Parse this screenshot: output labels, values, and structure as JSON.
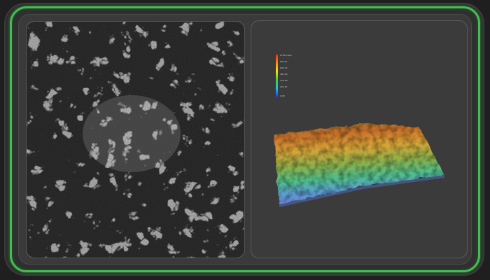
{
  "left_panel": {
    "image": "grayscale-surface-texture-micrograph"
  },
  "right_panel": {
    "image": "3d-surface-height-map"
  },
  "colorbar": {
    "colors": [
      "#ff2a00",
      "#ff8c00",
      "#ffe000",
      "#3ad13a",
      "#19c8e6",
      "#1a40ff"
    ],
    "labels": [
      "9790.74μm",
      "800.01",
      "640.74",
      "483.16",
      "326.28",
      "161.57",
      "0.00"
    ]
  },
  "accent_color": "#3fbf4f"
}
